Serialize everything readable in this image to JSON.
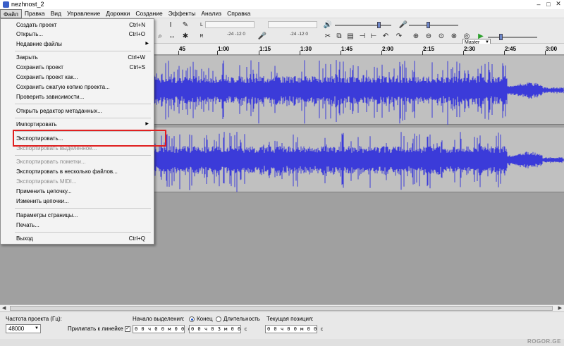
{
  "window": {
    "title": "nezhnost_2"
  },
  "menubar": [
    "Файл",
    "Правка",
    "Вид",
    "Управление",
    "Дорожки",
    "Создание",
    "Эффекты",
    "Анализ",
    "Справка"
  ],
  "toolbar": {
    "meter_scale_left": "-24  -12  0",
    "meter_scale_right": "-24  -12  0",
    "master_label": "Master"
  },
  "ruler": [
    "45",
    "1:00",
    "1:15",
    "1:30",
    "1:45",
    "2:00",
    "2:15",
    "2:30",
    "2:45",
    "3:00"
  ],
  "file_menu": {
    "items": [
      {
        "label": "Создать проект",
        "shortcut": "Ctrl+N"
      },
      {
        "label": "Открыть...",
        "shortcut": "Ctrl+O"
      },
      {
        "label": "Недавние файлы",
        "submenu": true
      },
      {
        "label": "Закрыть",
        "shortcut": "Ctrl+W"
      },
      {
        "label": "Сохранить проект",
        "shortcut": "Ctrl+S"
      },
      {
        "label": "Сохранить проект как..."
      },
      {
        "label": "Сохранить сжатую копию проекта..."
      },
      {
        "label": "Проверить зависимости..."
      },
      {
        "label": "Открыть редактор метаданных..."
      },
      {
        "label": "Импортировать",
        "submenu": true
      },
      {
        "label": "Экспортировать..."
      },
      {
        "label": "Экспортировать выделенное...",
        "disabled": true
      },
      {
        "label": "Экспортировать пометки...",
        "disabled": true
      },
      {
        "label": "Экспортировать в несколько файлов..."
      },
      {
        "label": "Экспортировать MIDI...",
        "disabled": true
      },
      {
        "label": "Применить цепочку..."
      },
      {
        "label": "Изменить цепочки..."
      },
      {
        "label": "Параметры страницы..."
      },
      {
        "label": "Печать..."
      },
      {
        "label": "Выход",
        "shortcut": "Ctrl+Q"
      }
    ],
    "submenu_arrow": "▶"
  },
  "statusbar": {
    "rate_label": "Частота проекта (Гц):",
    "rate_value": "48000",
    "snap_label": "Прилипать к линейке",
    "selection_start_label": "Начало выделения:",
    "end_label": "Конец",
    "length_label": "Длительность",
    "position_label": "Текущая позиция:",
    "time_start": "0 0 ч 0 0 м 0 0 с",
    "time_end": "0 0 ч 0 3 м 0 6 с",
    "time_position": "0 0 ч 0 0 м 0 0 с"
  },
  "watermark": "ROGOR.GE",
  "colors": {
    "waveform": "#3b3bd9",
    "highlight": "#e02020",
    "track_bg": "#c0c0c0"
  }
}
